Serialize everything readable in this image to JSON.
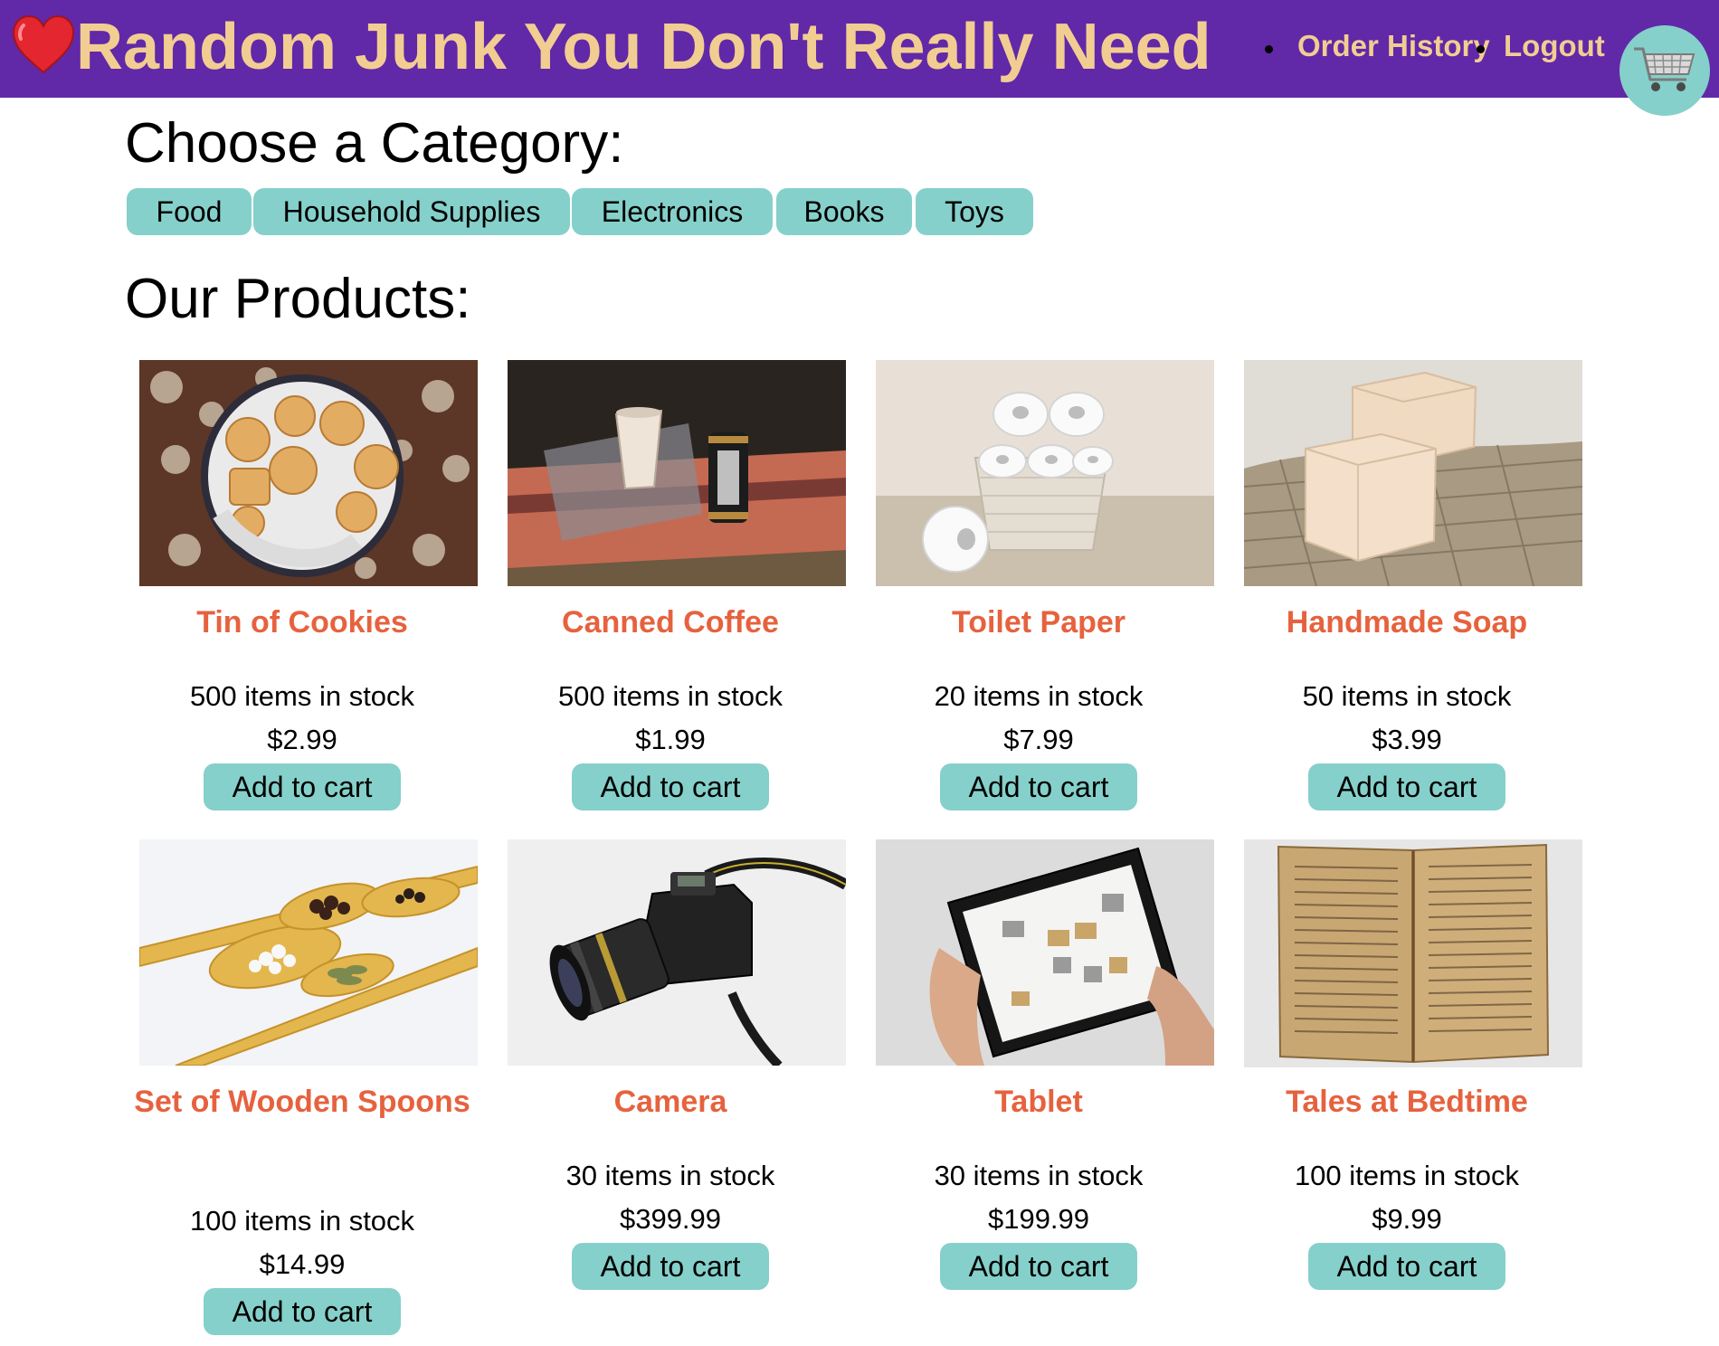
{
  "header": {
    "title": "Random Junk You Don't Really Need",
    "logo_icon": "heart-icon",
    "nav": [
      {
        "label": "Order History"
      },
      {
        "label": "Logout"
      }
    ],
    "cart_icon": "shopping-cart-icon"
  },
  "categories": {
    "heading": "Choose a Category:",
    "items": [
      {
        "label": "Food"
      },
      {
        "label": "Household Supplies"
      },
      {
        "label": "Electronics"
      },
      {
        "label": "Books"
      },
      {
        "label": "Toys"
      }
    ]
  },
  "products": {
    "heading": "Our Products:",
    "add_label": "Add to cart",
    "items": [
      {
        "name": "Tin of Cookies",
        "stock": "500 items in stock",
        "price": "$2.99"
      },
      {
        "name": "Canned Coffee",
        "stock": "500 items in stock",
        "price": "$1.99"
      },
      {
        "name": "Toilet Paper",
        "stock": "20 items in stock",
        "price": "$7.99"
      },
      {
        "name": "Handmade Soap",
        "stock": "50 items in stock",
        "price": "$3.99"
      },
      {
        "name": "Set of Wooden Spoons",
        "stock": "100 items in stock",
        "price": "$14.99"
      },
      {
        "name": "Camera",
        "stock": "30 items in stock",
        "price": "$399.99"
      },
      {
        "name": "Tablet",
        "stock": "30 items in stock",
        "price": "$199.99"
      },
      {
        "name": "Tales at Bedtime",
        "stock": "100 items in stock",
        "price": "$9.99"
      }
    ]
  },
  "colors": {
    "header_bg": "#6128a8",
    "title": "#f2cd92",
    "accent": "#85d0ca",
    "product_name": "#e6623e"
  }
}
